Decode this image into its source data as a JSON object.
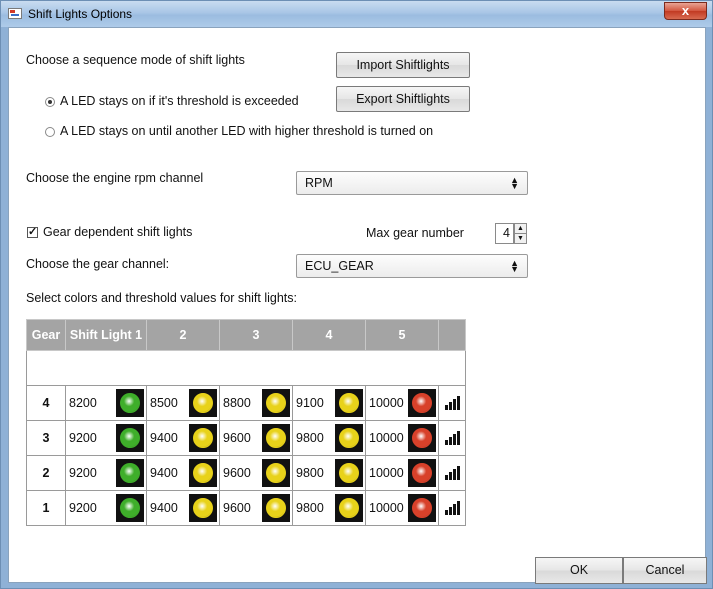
{
  "window": {
    "title": "Shift Lights Options",
    "close_label": "x"
  },
  "sequence": {
    "heading": "Choose a sequence mode of shift lights",
    "options": [
      {
        "label": "A LED stays on if it's threshold is exceeded",
        "selected": true
      },
      {
        "label": "A LED stays on until another LED with higher threshold is turned on",
        "selected": false
      }
    ]
  },
  "buttons": {
    "import": "Import Shiftlights",
    "export": "Export Shiftlights",
    "ok": "OK",
    "cancel": "Cancel"
  },
  "rpm": {
    "label": "Choose the engine rpm channel",
    "value": "RPM"
  },
  "gear": {
    "dependent_label": "Gear dependent shift lights",
    "dependent_checked": true,
    "max_label": "Max gear number",
    "max_value": "4",
    "channel_label": "Choose the gear channel:",
    "channel_value": "ECU_GEAR"
  },
  "thresholds": {
    "label": "Select colors and threshold values for shift lights:",
    "headers": [
      "Gear",
      "Shift Light 1",
      "2",
      "3",
      "4",
      "5"
    ],
    "rows": [
      {
        "gear": "4",
        "values": [
          "8200",
          "8500",
          "8800",
          "9100",
          "10000"
        ]
      },
      {
        "gear": "3",
        "values": [
          "9200",
          "9400",
          "9600",
          "9800",
          "10000"
        ]
      },
      {
        "gear": "2",
        "values": [
          "9200",
          "9400",
          "9600",
          "9800",
          "10000"
        ]
      },
      {
        "gear": "1",
        "values": [
          "9200",
          "9400",
          "9600",
          "9800",
          "10000"
        ]
      }
    ],
    "led_colors": [
      "#3fae2a",
      "#e8d21a",
      "#e8d21a",
      "#e8d21a",
      "#d8412a"
    ]
  },
  "icons": {
    "app": "app-window-icon",
    "bars": "bar-chart-icon"
  }
}
